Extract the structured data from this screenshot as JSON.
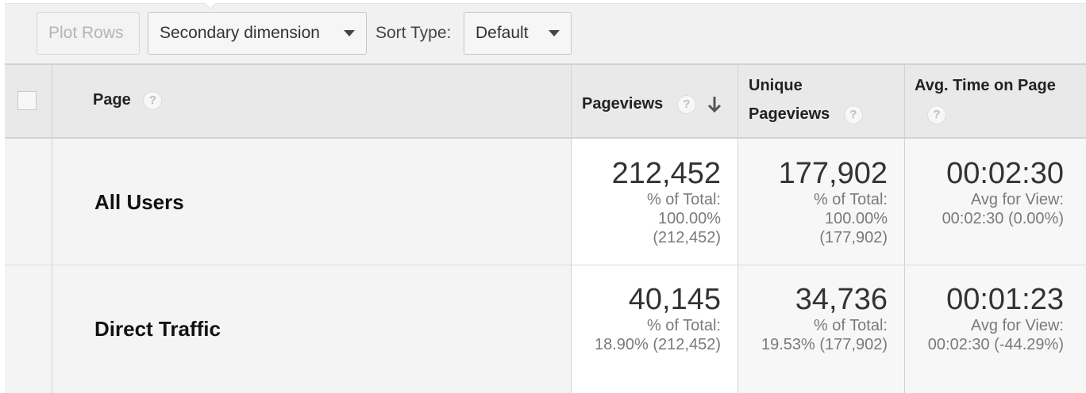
{
  "toolbar": {
    "plot_rows": "Plot Rows",
    "secondary_dimension": "Secondary dimension",
    "sort_type_label": "Sort Type:",
    "sort_type_value": "Default"
  },
  "table": {
    "headers": {
      "page": "Page",
      "pageviews": "Pageviews",
      "unique_line1": "Unique",
      "unique_line2": "Pageviews",
      "avg_time": "Avg. Time on Page"
    },
    "help_glyph": "?",
    "rows": [
      {
        "label": "All Users",
        "pageviews": "212,452",
        "pageviews_sub": [
          "% of Total:",
          "100.00%",
          "(212,452)"
        ],
        "unique": "177,902",
        "unique_sub": [
          "% of Total:",
          "100.00%",
          "(177,902)"
        ],
        "avg_time": "00:02:30",
        "avg_time_sub": [
          "Avg for View:",
          "00:02:30 (0.00%)"
        ]
      },
      {
        "label": "Direct Traffic",
        "pageviews": "40,145",
        "pageviews_sub": [
          "% of Total:",
          "18.90% (212,452)"
        ],
        "unique": "34,736",
        "unique_sub": [
          "% of Total:",
          "19.53% (177,902)"
        ],
        "avg_time": "00:01:23",
        "avg_time_sub": [
          "Avg for View:",
          "00:02:30 (-44.29%)"
        ]
      }
    ]
  },
  "icons": {
    "help": "question-circle-icon",
    "sort": "arrow-down-icon",
    "dropdown": "caret-down-icon"
  }
}
